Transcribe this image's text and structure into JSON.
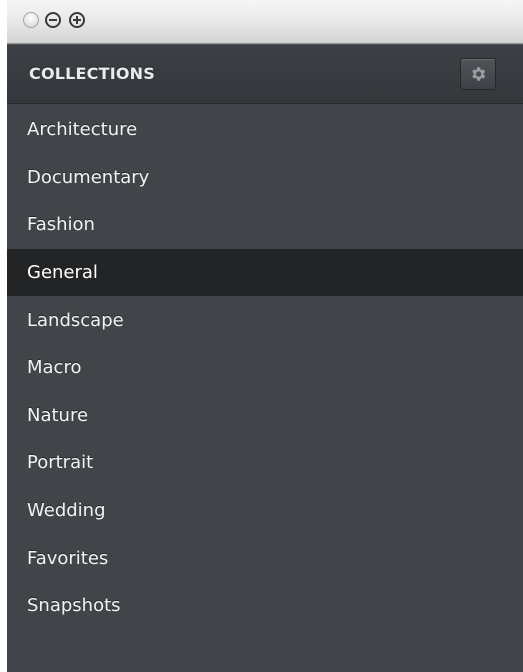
{
  "window": {
    "controls": {
      "close_icon": "close-circle-icon",
      "minimize_icon": "minus-circle-icon",
      "zoom_icon": "plus-circle-icon"
    }
  },
  "panel": {
    "title": "COLLECTIONS",
    "settings_icon": "gear-icon",
    "selected_index": 3,
    "items": [
      {
        "label": "Architecture"
      },
      {
        "label": "Documentary"
      },
      {
        "label": "Fashion"
      },
      {
        "label": "General"
      },
      {
        "label": "Landscape"
      },
      {
        "label": "Macro"
      },
      {
        "label": "Nature"
      },
      {
        "label": "Portrait"
      },
      {
        "label": "Wedding"
      },
      {
        "label": "Favorites"
      },
      {
        "label": "Snapshots"
      }
    ]
  },
  "colors": {
    "panel_background": "#414549",
    "header_background": "#383b3f",
    "selected_row": "#232426",
    "text": "#f2f3f3"
  }
}
